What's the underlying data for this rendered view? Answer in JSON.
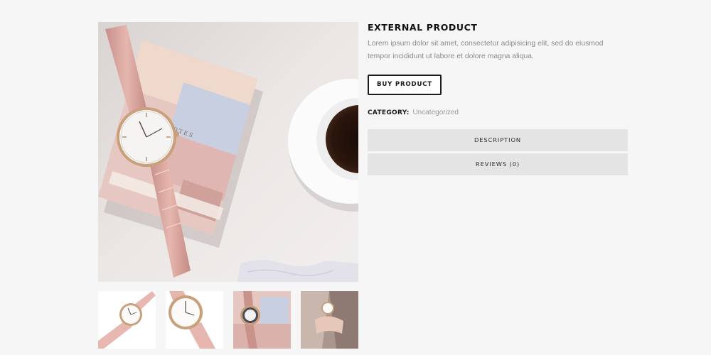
{
  "product": {
    "title": "EXTERNAL PRODUCT",
    "description": "Lorem ipsum dolor sit amet, consectetur adipisicing elit, sed do eiusmod tempor incididunt ut labore et dolore magna aliqua.",
    "buy_button_label": "BUY PRODUCT",
    "category_label": "CATEGORY:",
    "category_value": "Uncategorized"
  },
  "tabs": [
    {
      "label": "DESCRIPTION"
    },
    {
      "label": "REVIEWS (0)"
    }
  ],
  "gallery": {
    "main_image": "watch-on-notebook-with-coffee",
    "thumbnails": [
      {
        "icon": "pink-watch-angled"
      },
      {
        "icon": "pink-watch-closeup"
      },
      {
        "icon": "watch-on-notebook"
      },
      {
        "icon": "watch-on-wrist"
      }
    ]
  },
  "colors": {
    "background": "#f6f6f6",
    "tab_background": "#e4e4e4",
    "button_border": "#1b1b1b",
    "muted_text": "#8a8a8a"
  }
}
